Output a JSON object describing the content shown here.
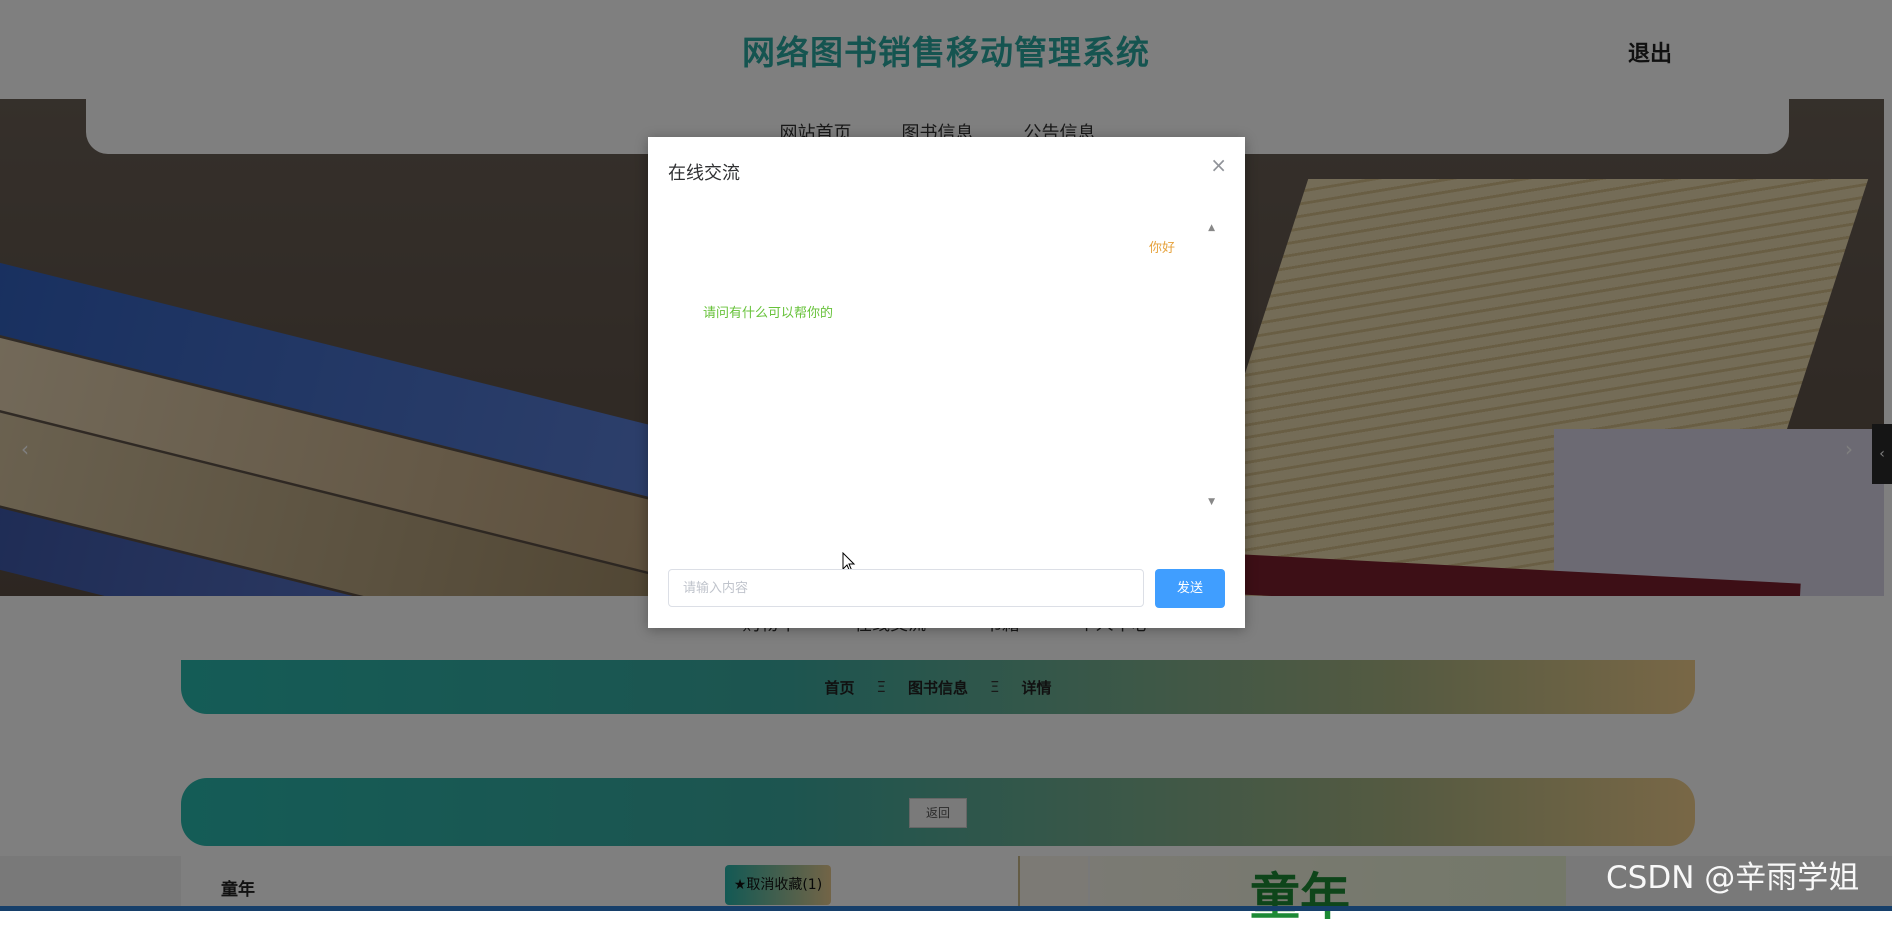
{
  "header": {
    "site_title": "网络图书销售移动管理系统",
    "logout": "退出",
    "nav": [
      "网站首页",
      "图书信息",
      "公告信息"
    ]
  },
  "banner": {
    "prev_icon": "chevron-left",
    "next_icon": "chevron-right"
  },
  "toolbar": [
    "购物车",
    "在线交流",
    "书籍",
    "个人中心"
  ],
  "breadcrumb": {
    "items": [
      "首页",
      "图书信息",
      "详情"
    ],
    "separator": "Ξ"
  },
  "back_button": "返回",
  "product": {
    "name": "童年",
    "favorite_button": "★取消收藏(1)",
    "cover_title": "童年"
  },
  "watermark": "CSDN @辛雨学姐",
  "dialog": {
    "title": "在线交流",
    "close_icon": "×",
    "messages": [
      {
        "side": "right",
        "text": "你好"
      },
      {
        "side": "left",
        "text": "请问有什么可以帮你的"
      }
    ],
    "input_placeholder": "请输入内容",
    "send_label": "发送"
  },
  "colors": {
    "brand_teal": "#2ba9a1",
    "send_blue": "#409eff",
    "user_msg": "#e6a23c",
    "reply_msg": "#67c23a"
  }
}
